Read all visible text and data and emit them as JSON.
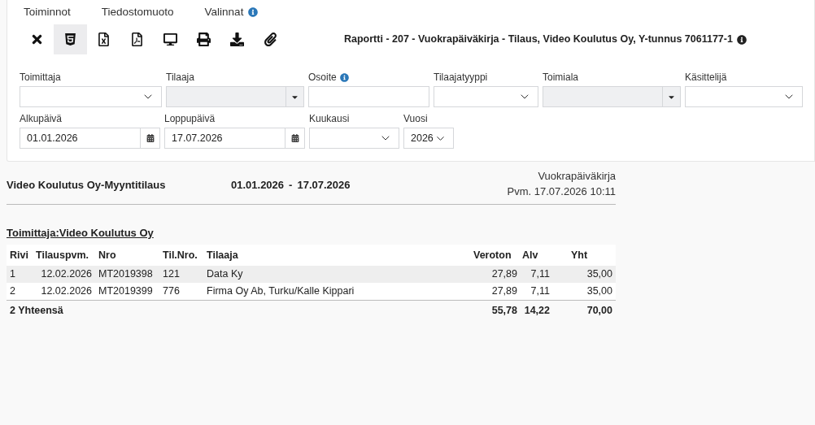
{
  "menu": [
    {
      "label": "Toiminnot",
      "info": false
    },
    {
      "label": "Tiedostomuoto",
      "info": false
    },
    {
      "label": "Valinnat",
      "info": true
    }
  ],
  "toolbar": [
    {
      "kind": "close",
      "selected": false
    },
    {
      "kind": "html",
      "selected": true
    },
    {
      "kind": "excel",
      "selected": false
    },
    {
      "kind": "pdf",
      "selected": false
    },
    {
      "kind": "screen",
      "selected": false
    },
    {
      "kind": "print",
      "selected": false
    },
    {
      "kind": "download",
      "selected": false
    },
    {
      "kind": "attach",
      "selected": false
    }
  ],
  "report_title": "Raportti - 207 - Vuokrapäiväkirja - Tilaus, Video Koulutus Oy, Y-tunnus 7061177-1",
  "filters": [
    [
      {
        "label": "Toimittaja",
        "kind": "select",
        "disabled": false,
        "info": false
      },
      {
        "label": "Tilaaja",
        "kind": "combo",
        "disabled": true,
        "info": false
      },
      {
        "label": "Osoite",
        "kind": "text",
        "disabled": false,
        "info": true
      },
      {
        "label": "Tilaajatyyppi",
        "kind": "select",
        "disabled": false,
        "info": false
      },
      {
        "label": "Toimiala",
        "kind": "combo",
        "disabled": true,
        "info": false
      },
      {
        "label": "Käsittelijä",
        "kind": "select",
        "disabled": false,
        "info": false
      }
    ],
    [
      {
        "label": "Alkupäivä",
        "kind": "date",
        "value": "01.01.2026",
        "disabled": false,
        "info": false
      },
      {
        "label": "Loppupäivä",
        "kind": "date",
        "value": "17.07.2026",
        "disabled": false,
        "info": false
      },
      {
        "label": "Kuukausi",
        "kind": "select",
        "disabled": false,
        "info": false
      },
      {
        "label": "Vuosi",
        "kind": "year",
        "value": "2026",
        "disabled": false,
        "info": false
      }
    ]
  ],
  "report": {
    "heading": "Video Koulutus Oy-Myyntitilaus",
    "period_start": "01.01.2026",
    "period_separator": "-",
    "period_end": "17.07.2026",
    "report_name": "Vuokrapäiväkirja",
    "printed": "Pvm. 17.07.2026 10:11",
    "supplier": "Toimittaja:Video Koulutus Oy",
    "columns": [
      "Rivi",
      "Tilauspvm.",
      "Nro",
      "Til.Nro.",
      "Tilaaja",
      "Veroton",
      "Alv",
      "Yht"
    ],
    "rows": [
      {
        "highlighted": true,
        "cells": [
          "1",
          "12.02.2026",
          "MT2019398",
          "121",
          "Data Ky",
          "27,89",
          "7,11",
          "35,00"
        ]
      },
      {
        "highlighted": false,
        "cells": [
          "2",
          "12.02.2026",
          "MT2019399",
          "776",
          "Firma Oy Ab, Turku/Kalle Kippari",
          "27,89",
          "7,11",
          "35,00"
        ]
      }
    ],
    "total": {
      "label": "2 Yhteensä",
      "veroton": "55,78",
      "alv": "14,22",
      "yht": "70,00"
    }
  }
}
